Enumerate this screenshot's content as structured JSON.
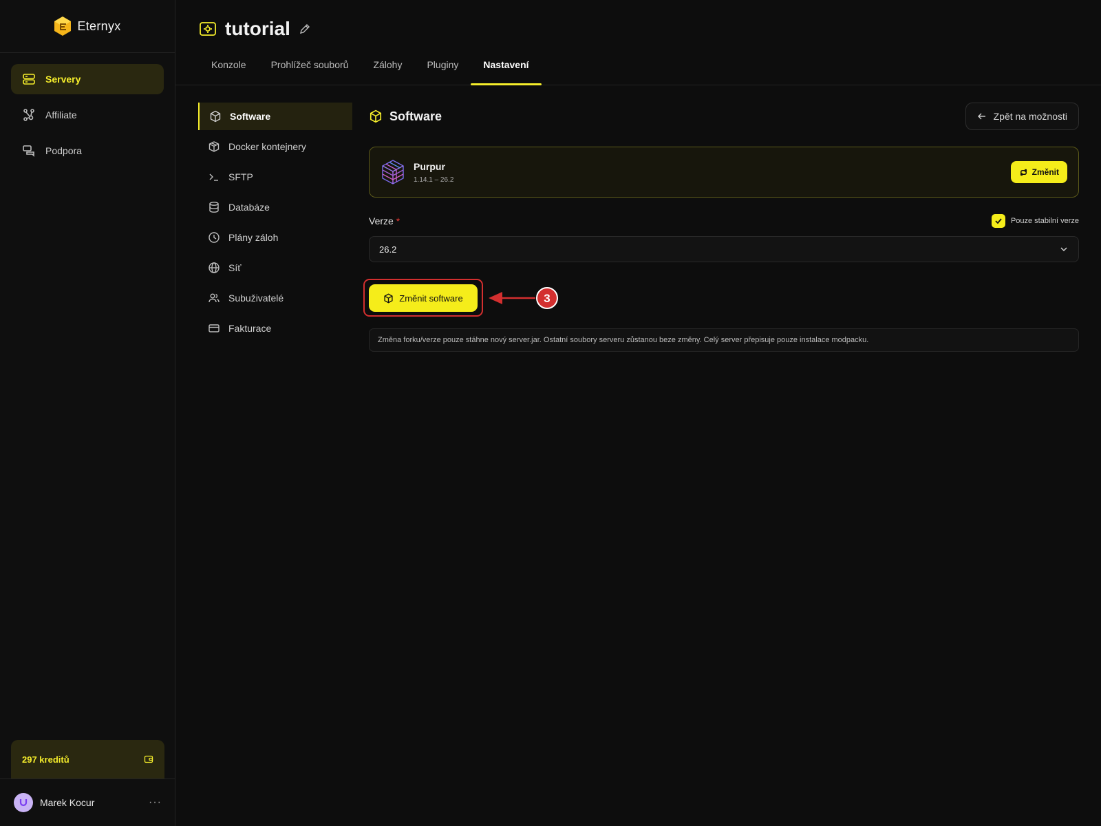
{
  "brand": {
    "name": "Eternyx"
  },
  "sidebar": {
    "items": [
      {
        "label": "Servery",
        "icon": "server-icon",
        "active": true
      },
      {
        "label": "Affiliate",
        "icon": "affiliate-icon",
        "active": false
      },
      {
        "label": "Podpora",
        "icon": "chat-icon",
        "active": false
      }
    ],
    "credits_label": "297 kreditů",
    "user_name": "Marek Kocur",
    "more_label": "···"
  },
  "header": {
    "server_name": "tutorial",
    "tabs": [
      {
        "label": "Konzole",
        "active": false
      },
      {
        "label": "Prohlížeč souborů",
        "active": false
      },
      {
        "label": "Zálohy",
        "active": false
      },
      {
        "label": "Pluginy",
        "active": false
      },
      {
        "label": "Nastavení",
        "active": true
      }
    ]
  },
  "submenu": {
    "items": [
      {
        "label": "Software",
        "icon": "box-icon",
        "active": true
      },
      {
        "label": "Docker kontejnery",
        "icon": "container-icon",
        "active": false
      },
      {
        "label": "SFTP",
        "icon": "terminal-icon",
        "active": false
      },
      {
        "label": "Databáze",
        "icon": "database-icon",
        "active": false
      },
      {
        "label": "Plány záloh",
        "icon": "clock-icon",
        "active": false
      },
      {
        "label": "Síť",
        "icon": "globe-icon",
        "active": false
      },
      {
        "label": "Subuživatelé",
        "icon": "users-icon",
        "active": false
      },
      {
        "label": "Fakturace",
        "icon": "card-icon",
        "active": false
      }
    ]
  },
  "content": {
    "title": "Software",
    "back_label": "Zpět na možnosti",
    "software": {
      "name": "Purpur",
      "range": "1.14.1 – 26.2",
      "change_label": "Změnit"
    },
    "version_label": "Verze",
    "required_mark": "*",
    "stable_label": "Pouze stabilní verze",
    "stable_checked": true,
    "version_value": "26.2",
    "primary_button": "Změnit software",
    "annotation_number": "3",
    "note": "Změna forku/verze pouze stáhne nový server.jar. Ostatní soubory serveru zůstanou beze změny. Celý server přepisuje pouze instalace modpacku."
  },
  "colors": {
    "accent": "#f5ed1a",
    "background": "#0d0d0d",
    "annotation": "#d32f2f"
  }
}
